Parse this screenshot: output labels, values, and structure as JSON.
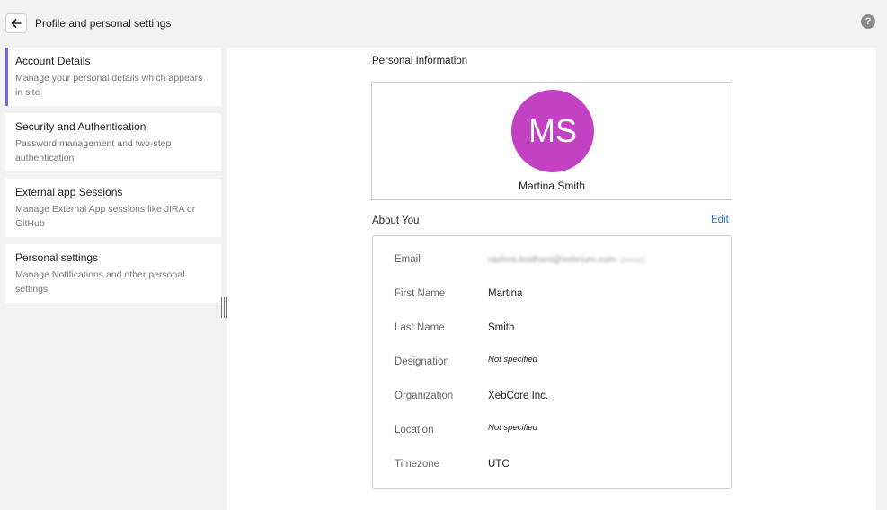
{
  "header": {
    "title": "Profile and personal settings",
    "back_icon": "arrow-left-icon",
    "help_icon": "question-circle-icon",
    "help_glyph": "?"
  },
  "sidebar": {
    "accent_color": "#7a63d8",
    "items": [
      {
        "title": "Account Details",
        "description": "Manage your personal details which appears in site",
        "active": true
      },
      {
        "title": "Security and Authentication",
        "description": "Password management and two-step authentication",
        "active": false
      },
      {
        "title": "External app Sessions",
        "description": "Manage External App sessions like JIRA or GitHub",
        "active": false
      },
      {
        "title": "Personal settings",
        "description": "Manage Notifications and other personal settings",
        "active": false
      }
    ]
  },
  "personal_info": {
    "heading": "Personal Information",
    "avatar_initials": "MS",
    "avatar_color": "#c342c3",
    "name": "Martina Smith"
  },
  "about": {
    "heading": "About You",
    "edit_label": "Edit",
    "fields": [
      {
        "label": "Email",
        "value": "rashmi.bodhani@xebrium.com",
        "badge": "(Admin)"
      },
      {
        "label": "First Name",
        "value": "Martina"
      },
      {
        "label": "Last Name",
        "value": "Smith"
      },
      {
        "label": "Designation",
        "value": "Not specified"
      },
      {
        "label": "Organization",
        "value": "XebCore Inc."
      },
      {
        "label": "Location",
        "value": "Not specified"
      },
      {
        "label": "Timezone",
        "value": "UTC"
      }
    ]
  }
}
